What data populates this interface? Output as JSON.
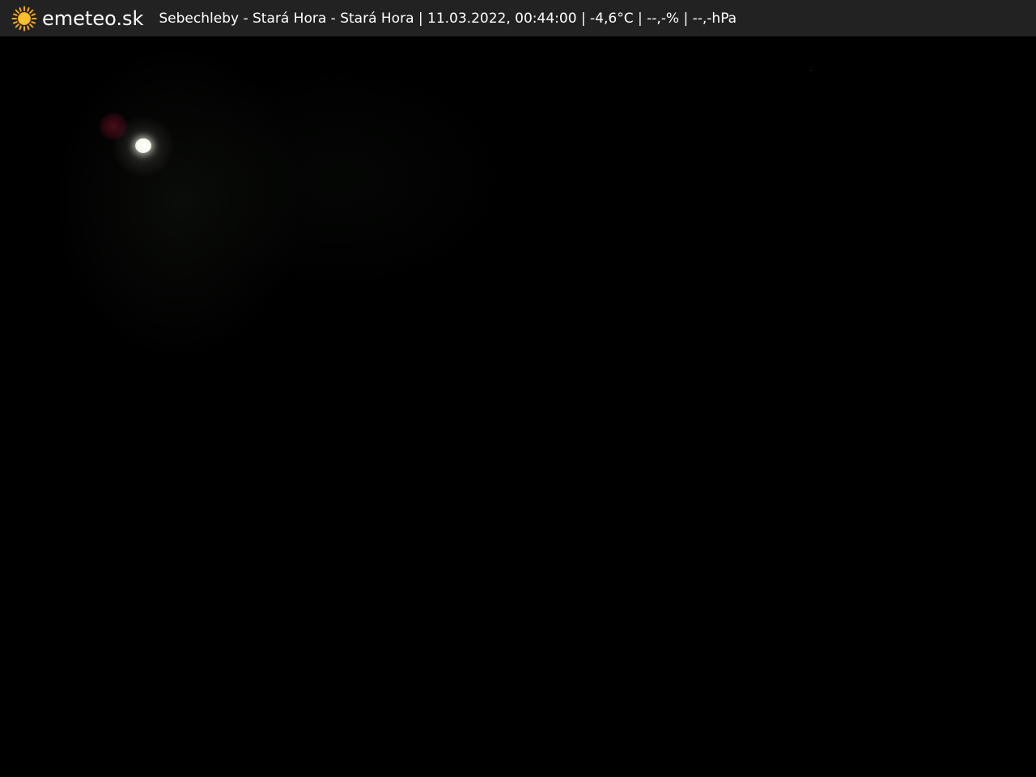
{
  "header": {
    "brand": "emeteo.sk",
    "logo_icon": "sun-icon",
    "caption": "Sebechleby - Stará Hora - Stará Hora | 11.03.2022, 00:44:00 | -4,6°C | --,-% | --,-hPa"
  },
  "colors": {
    "header_background": "#222222",
    "header_text": "#ffffff",
    "sun_accent": "#f5a623",
    "image_background": "#000000"
  }
}
